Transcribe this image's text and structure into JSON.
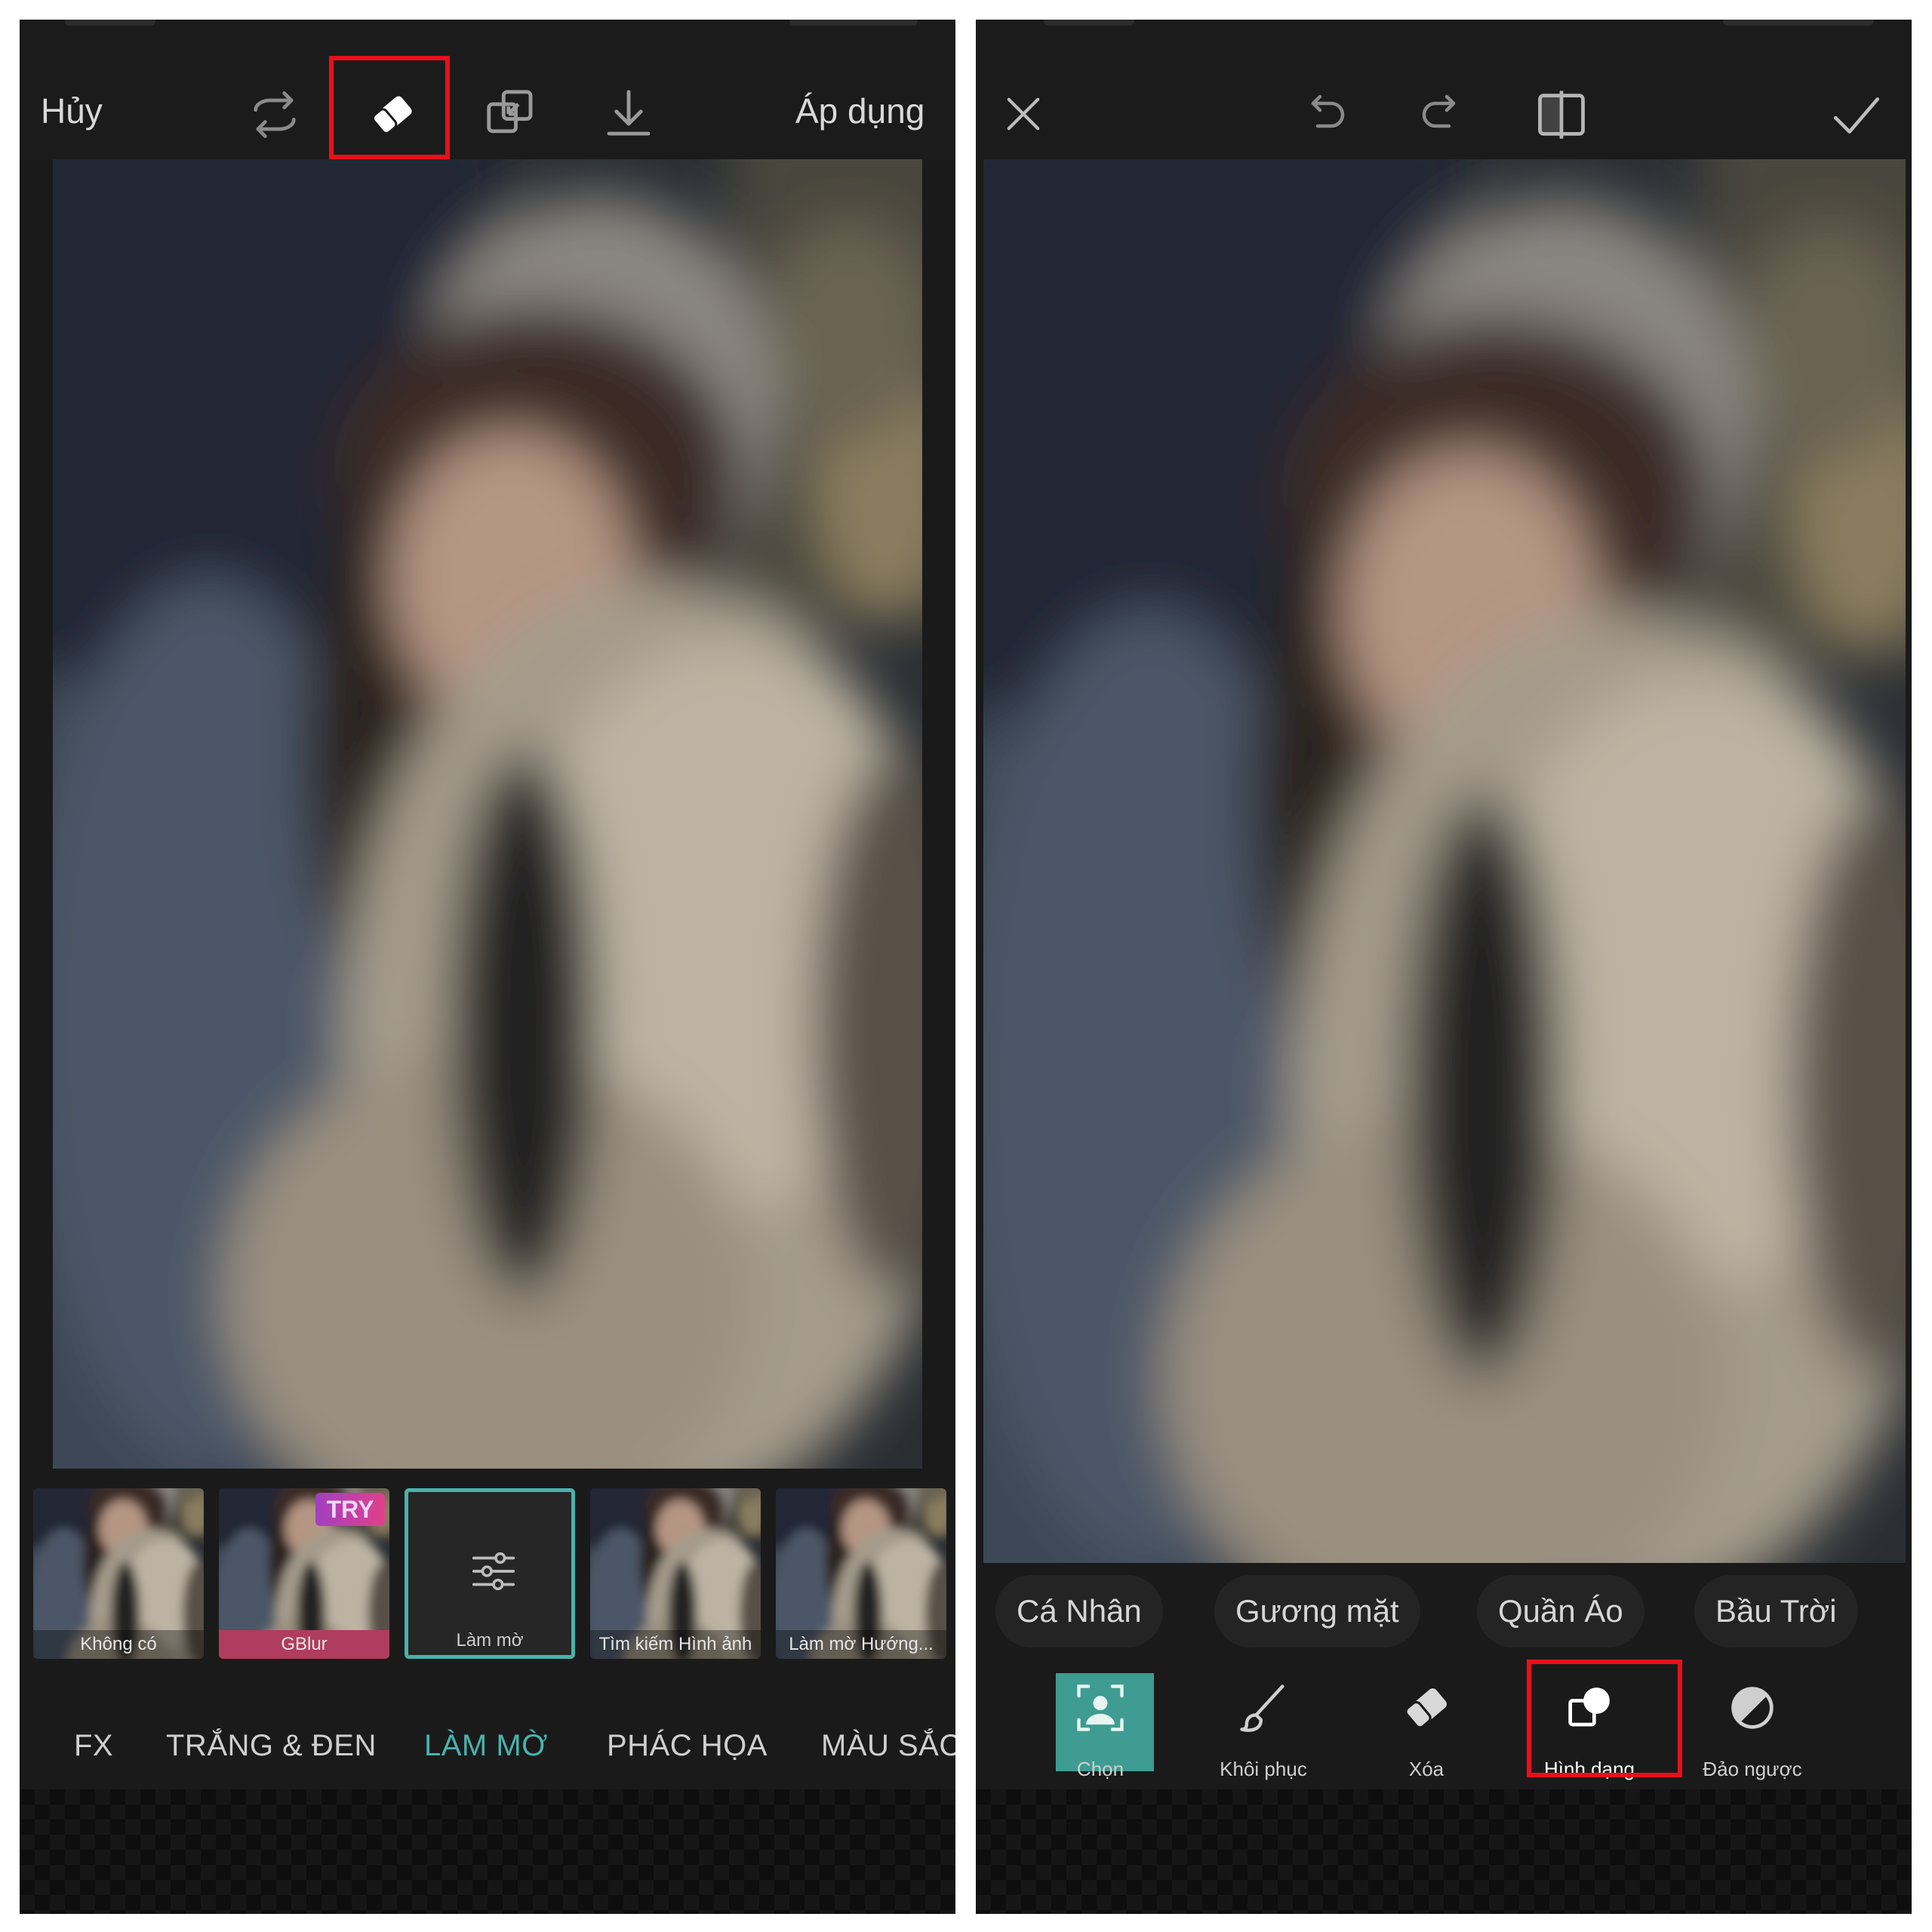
{
  "left_screen": {
    "topbar": {
      "cancel_label": "Hủy",
      "apply_label": "Áp dụng",
      "icons": [
        "repeat-icon",
        "eraser-icon",
        "copy-layers-icon",
        "download-icon"
      ]
    },
    "thumbnails": [
      {
        "label": "Không có"
      },
      {
        "label": "GBlur",
        "badge": "TRY"
      },
      {
        "label": "Làm mờ"
      },
      {
        "label": "Tìm kiếm Hình ảnh"
      },
      {
        "label": "Làm mờ Hướng..."
      }
    ],
    "categories": [
      {
        "label": "FX"
      },
      {
        "label": "TRẮNG & ĐEN"
      },
      {
        "label": "LÀM MỜ"
      },
      {
        "label": "PHÁC HỌA"
      },
      {
        "label": "MÀU SẮC"
      }
    ],
    "active_category": "LÀM MỜ"
  },
  "right_screen": {
    "topbar": {
      "icons": [
        "close-icon",
        "undo-icon",
        "redo-icon",
        "compare-icon",
        "check-icon"
      ]
    },
    "segments": [
      {
        "label": "Cá Nhân"
      },
      {
        "label": "Gương mặt"
      },
      {
        "label": "Quần Áo"
      },
      {
        "label": "Bầu Trời"
      }
    ],
    "tools": [
      {
        "label": "Chọn",
        "icon": "person-select-icon"
      },
      {
        "label": "Khôi phục",
        "icon": "brush-icon"
      },
      {
        "label": "Xóa",
        "icon": "eraser-icon"
      },
      {
        "label": "Hình dạng",
        "icon": "shapes-icon"
      },
      {
        "label": "Đảo ngược",
        "icon": "invert-icon"
      }
    ]
  },
  "colors": {
    "accent": "#49b3ab",
    "highlight": "#e8101a",
    "background": "#1a1a1a",
    "select_tool": "#3e9c92"
  }
}
